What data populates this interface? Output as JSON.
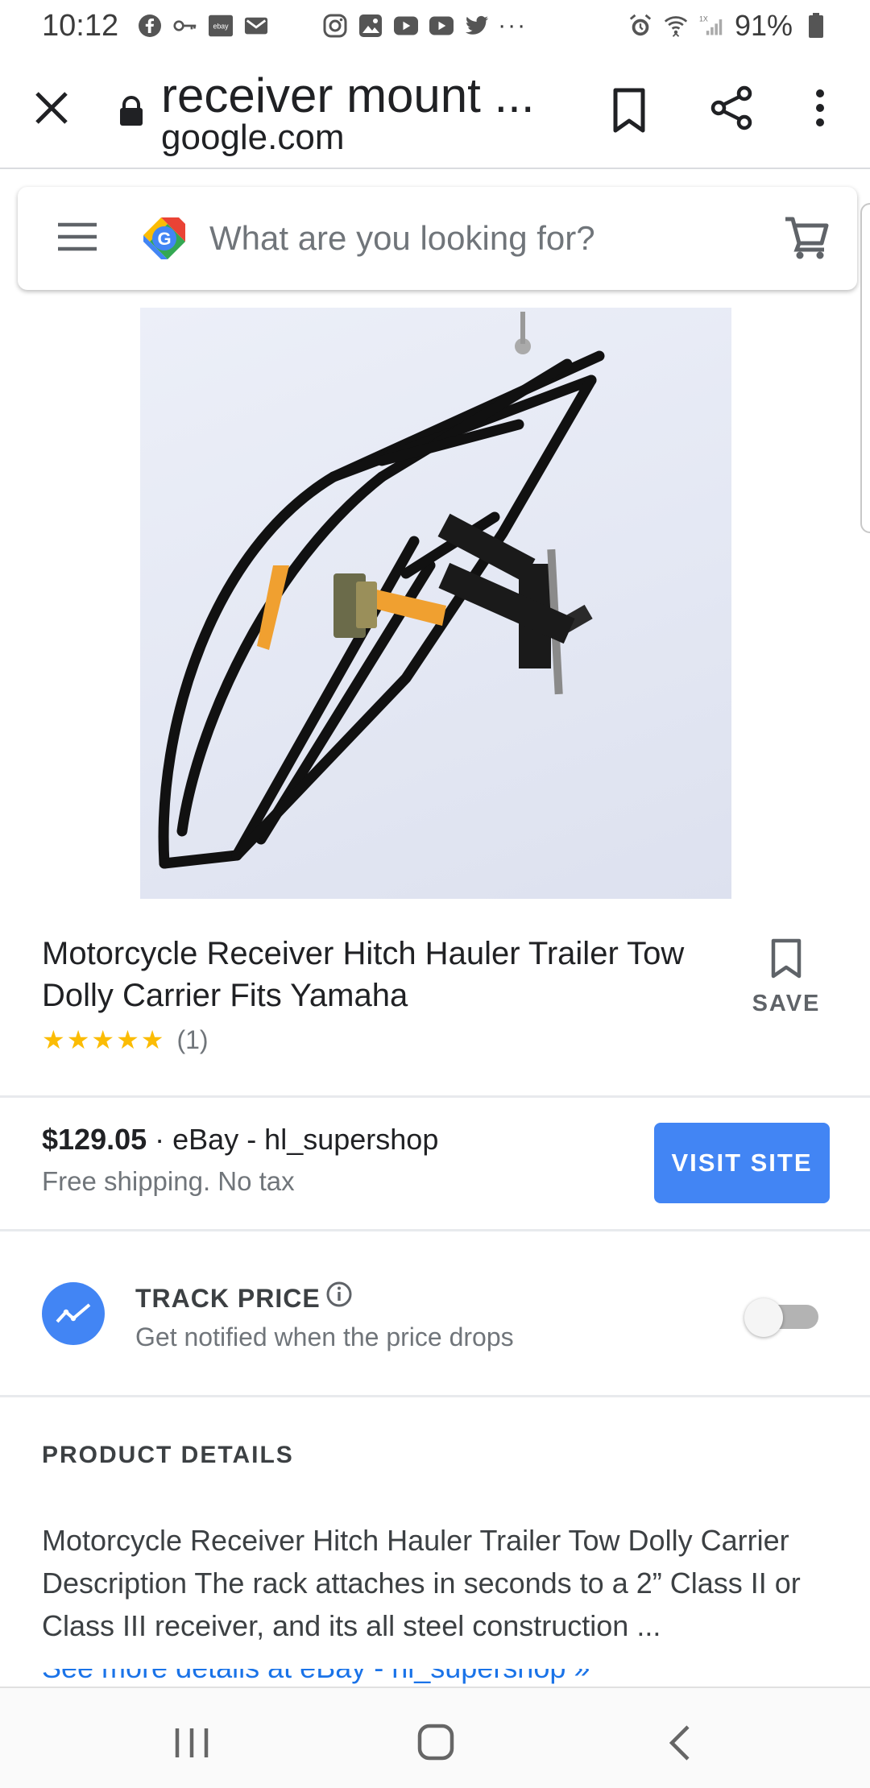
{
  "status_bar": {
    "time": "10:12",
    "notification_icons": [
      "facebook-icon",
      "key-icon",
      "ebay-icon",
      "mail-icon",
      "instagram-icon",
      "gallery-icon",
      "youtube-icon",
      "youtube-icon",
      "twitter-icon",
      "more-notifications-icon"
    ],
    "system_icons": [
      "alarm-icon",
      "wifi-icon",
      "signal-icon",
      "battery-icon"
    ],
    "battery": "91%"
  },
  "browser_bar": {
    "page_title": "receiver mount ...",
    "domain": "google.com"
  },
  "search": {
    "placeholder": "What are you looking for?"
  },
  "product": {
    "title": "Motorcycle Receiver Hitch Hauler Trailer Tow Dolly Carrier Fits Yamaha",
    "stars": "★★★★★",
    "rating_value": 5,
    "review_count": "(1)",
    "save_label": "SAVE"
  },
  "offer": {
    "price": "$129.05",
    "seller": " · eBay - hl_supershop",
    "shipping": "Free shipping. No tax",
    "visit_label": "VISIT SITE"
  },
  "track_price": {
    "title": "TRACK PRICE",
    "subtitle": "Get notified when the price drops",
    "enabled": false
  },
  "details": {
    "heading": "PRODUCT DETAILS",
    "description": "Motorcycle Receiver Hitch Hauler Trailer Tow Dolly Carrier Description The rack attaches in seconds to a 2” Class II or Class III receiver, and its all steel construction ...",
    "more_link": "See more details at eBay - hl_supershop »"
  },
  "colors": {
    "accent": "#4285f4",
    "star": "#fbbc04",
    "link": "#1a73e8"
  }
}
